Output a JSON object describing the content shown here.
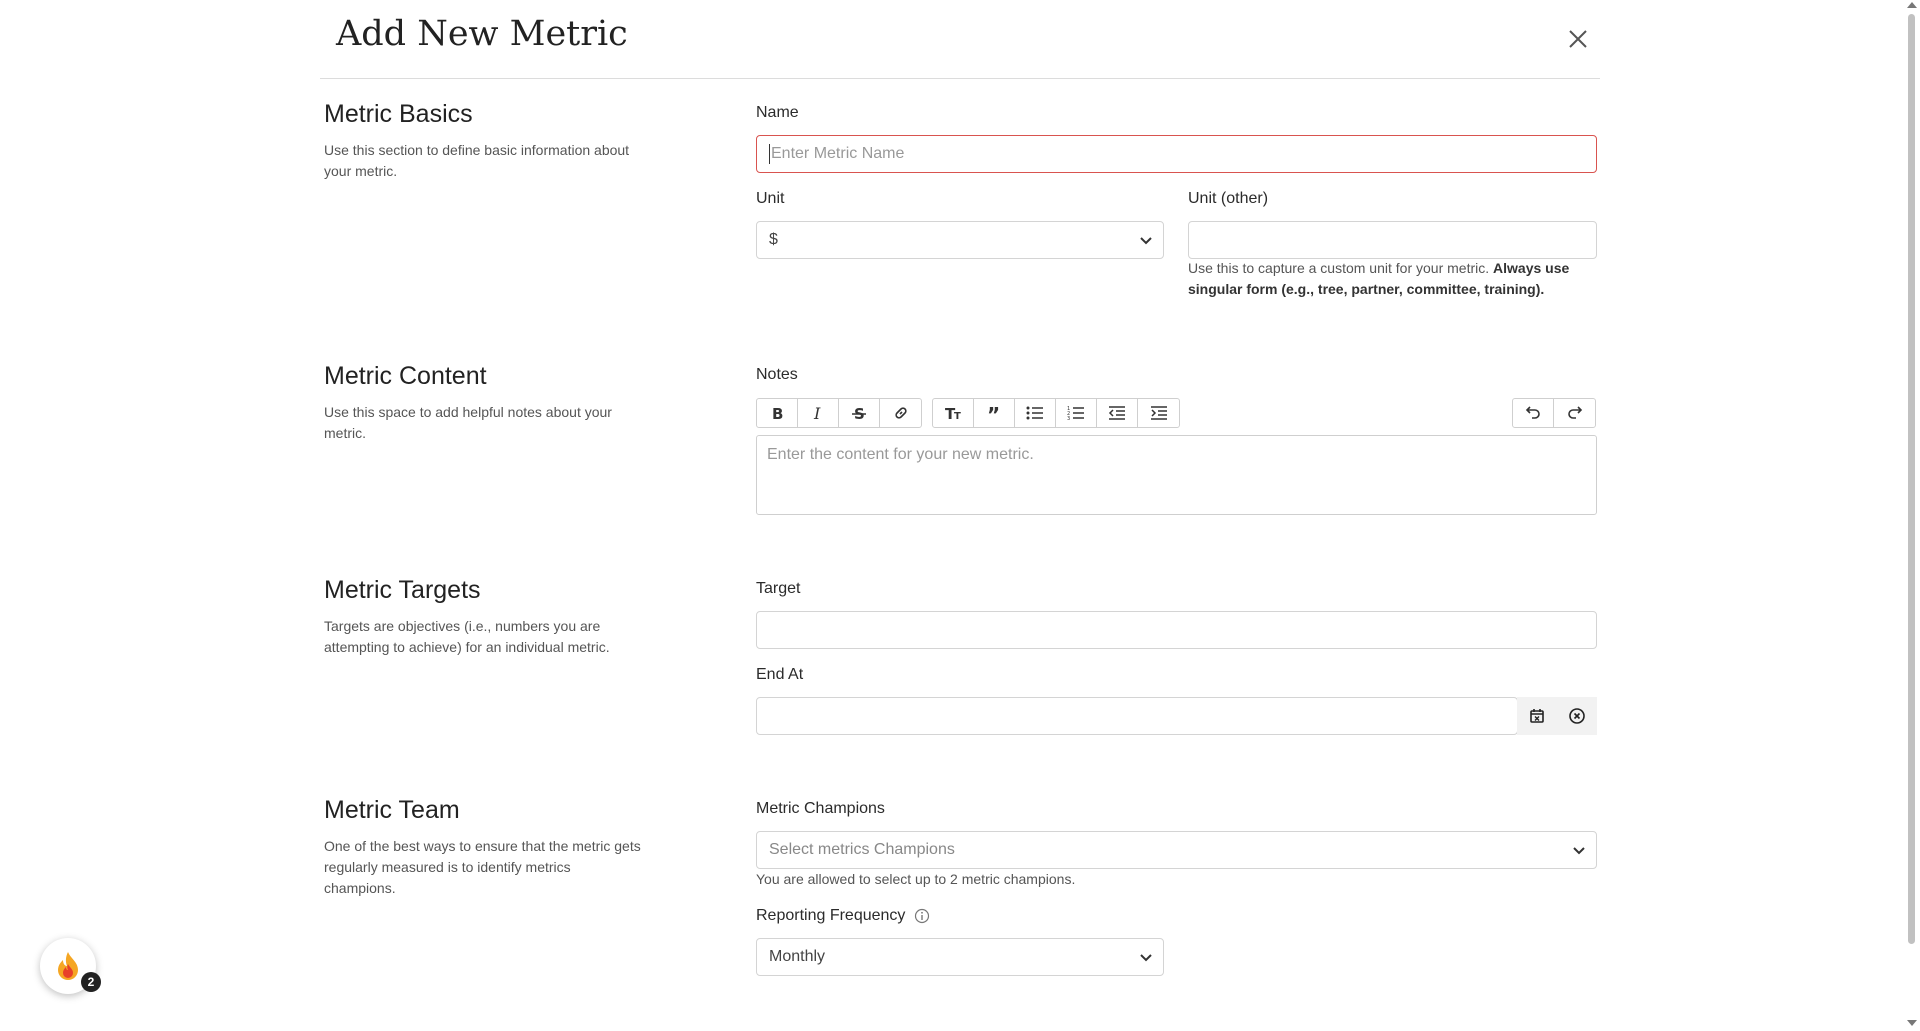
{
  "modal": {
    "title": "Add New Metric"
  },
  "sections": {
    "basics": {
      "title": "Metric Basics",
      "description": "Use this section to define basic information about your metric."
    },
    "content": {
      "title": "Metric Content",
      "description": "Use this space to add helpful notes about your metric."
    },
    "targets": {
      "title": "Metric Targets",
      "description": "Targets are objectives (i.e., numbers you are attempting to achieve) for an individual metric."
    },
    "team": {
      "title": "Metric Team",
      "description": "One of the best ways to ensure that the metric gets regularly measured is to identify metrics champions."
    }
  },
  "fields": {
    "name": {
      "label": "Name",
      "placeholder": "Enter Metric Name",
      "value": ""
    },
    "unit": {
      "label": "Unit",
      "value": "$"
    },
    "unit_other": {
      "label": "Unit (other)",
      "value": "",
      "help": "Use this to capture a custom unit for your metric.",
      "help_bold": "Always use singular form (e.g., tree, partner, committee, training)."
    },
    "notes": {
      "label": "Notes",
      "placeholder": "Enter the content for your new metric."
    },
    "target": {
      "label": "Target",
      "value": ""
    },
    "end_at": {
      "label": "End At",
      "value": ""
    },
    "champions": {
      "label": "Metric Champions",
      "placeholder": "Select metrics Champions",
      "help": "You are allowed to select up to 2 metric champions."
    },
    "frequency": {
      "label": "Reporting Frequency",
      "value": "Monthly"
    }
  },
  "toolbar": {
    "buttons": [
      "bold-icon",
      "italic-icon",
      "strikethrough-icon",
      "link-icon",
      "heading-icon",
      "quote-icon",
      "bullet-list-icon",
      "numbered-list-icon",
      "outdent-icon",
      "indent-icon",
      "undo-icon",
      "redo-icon"
    ]
  },
  "notification": {
    "count": "2"
  },
  "colors": {
    "error_border": "#d9534f",
    "fab_flame": "#f5a623"
  }
}
